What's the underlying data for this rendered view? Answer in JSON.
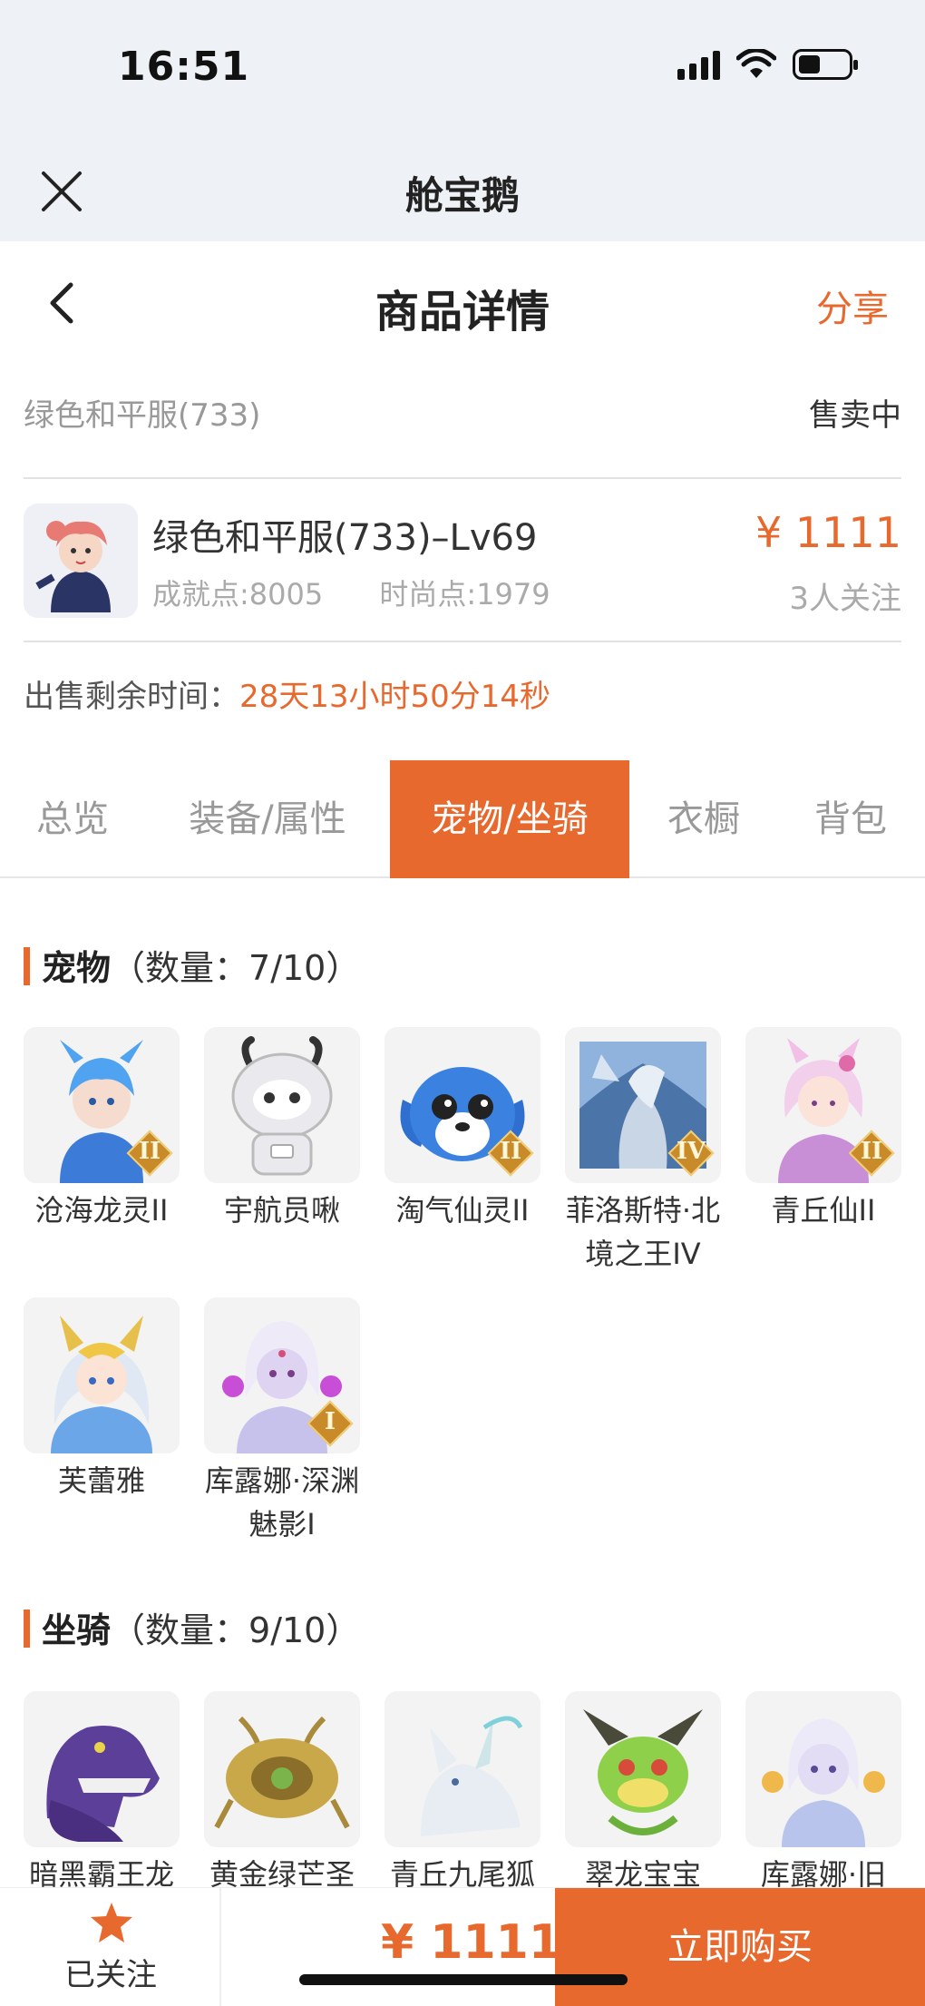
{
  "status_bar": {
    "time": "16:51"
  },
  "mini_program": {
    "title": "舱宝鹅"
  },
  "nav": {
    "title": "商品详情",
    "share": "分享"
  },
  "listing": {
    "server": "绿色和平服(733)",
    "status": "售卖中"
  },
  "product": {
    "name": "绿色和平服(733)–Lv69",
    "achievement": "成就点:8005",
    "fashion": "时尚点:1979",
    "price": "¥ 1111",
    "followers": "3人关注"
  },
  "remaining": {
    "label": "出售剩余时间：",
    "value": "28天13小时50分14秒"
  },
  "tabs": [
    {
      "label": "总览"
    },
    {
      "label": "装备/属性"
    },
    {
      "label": "宠物/坐骑",
      "active": true
    },
    {
      "label": "衣橱"
    },
    {
      "label": "背包"
    }
  ],
  "pets": {
    "title": "宠物",
    "count": "（数量：7/10）",
    "items": [
      {
        "name": "沧海龙灵II",
        "badge": "II"
      },
      {
        "name": "宇航员啾",
        "badge": ""
      },
      {
        "name": "淘气仙灵II",
        "badge": "II"
      },
      {
        "name": "菲洛斯特·北境之王IV",
        "badge": "IV"
      },
      {
        "name": "青丘仙II",
        "badge": "II"
      },
      {
        "name": "芙蕾雅",
        "badge": ""
      },
      {
        "name": "库露娜·深渊魅影I",
        "badge": "I"
      }
    ]
  },
  "mounts": {
    "title": "坐骑",
    "count": "（数量：9/10）",
    "items": [
      {
        "name": "暗黑霸王龙"
      },
      {
        "name": "黄金绿芒圣"
      },
      {
        "name": "青丘九尾狐"
      },
      {
        "name": "翠龙宝宝"
      },
      {
        "name": "库露娜·旧"
      }
    ]
  },
  "bottom": {
    "follow": "已关注",
    "price": "¥ 1111",
    "buy": "立即购买"
  },
  "colors": {
    "accent": "#e8692e",
    "badge": "#c98b2a"
  }
}
